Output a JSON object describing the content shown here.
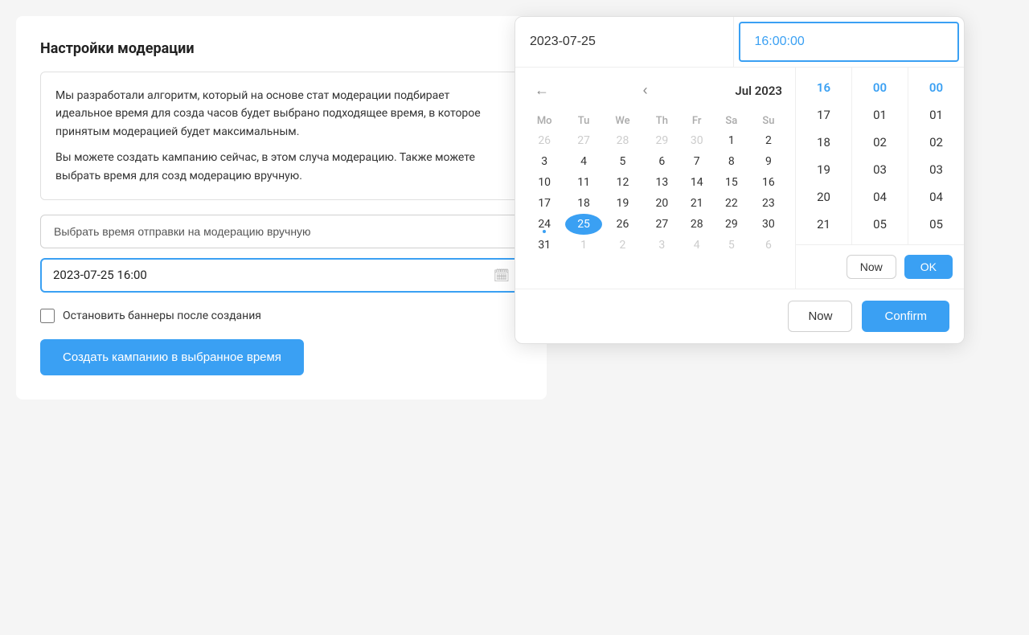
{
  "section": {
    "title": "Настройки модерации",
    "info_text_1": "Мы разработали алгоритм, который на основе стат модерации подбирает идеальное время для созда часов будет выбрано подходящее время, в которое принятым модерацией будет максимальным.",
    "info_text_2": "Вы можете создать кампанию сейчас, в этом случа модерацию. Также можете выбрать время для созд модерацию вручную.",
    "select_time_label": "Выбрать время отправки на модерацию вручную",
    "datetime_value": "2023-07-25 16:00",
    "checkbox_label": "Остановить баннеры после создания",
    "create_btn": "Создать кампанию в выбранное время"
  },
  "picker": {
    "date_input_value": "2023-07-25",
    "time_input_value": "16:00:00",
    "month_label": "Jul 2023",
    "nav_prev": "‹",
    "nav_prev2": "‹",
    "weekdays": [
      "Mo",
      "Tu",
      "We",
      "Th",
      "Fr",
      "Sa",
      "Su"
    ],
    "weeks": [
      [
        {
          "day": "26",
          "other": true
        },
        {
          "day": "27",
          "other": true
        },
        {
          "day": "28",
          "other": true
        },
        {
          "day": "29",
          "other": true
        },
        {
          "day": "30",
          "other": true
        },
        {
          "day": "1",
          "other": false
        },
        {
          "day": "2",
          "other": false
        }
      ],
      [
        {
          "day": "3",
          "other": false
        },
        {
          "day": "4",
          "other": false
        },
        {
          "day": "5",
          "other": false
        },
        {
          "day": "6",
          "other": false
        },
        {
          "day": "7",
          "other": false
        },
        {
          "day": "8",
          "other": false
        },
        {
          "day": "9",
          "other": false
        }
      ],
      [
        {
          "day": "10",
          "other": false
        },
        {
          "day": "11",
          "other": false
        },
        {
          "day": "12",
          "other": false
        },
        {
          "day": "13",
          "other": false
        },
        {
          "day": "14",
          "other": false
        },
        {
          "day": "15",
          "other": false
        },
        {
          "day": "16",
          "other": false
        }
      ],
      [
        {
          "day": "17",
          "other": false
        },
        {
          "day": "18",
          "other": false
        },
        {
          "day": "19",
          "other": false
        },
        {
          "day": "20",
          "other": false
        },
        {
          "day": "21",
          "other": false
        },
        {
          "day": "22",
          "other": false
        },
        {
          "day": "23",
          "other": false
        }
      ],
      [
        {
          "day": "24",
          "other": false,
          "dot": true
        },
        {
          "day": "25",
          "other": false,
          "selected": true
        },
        {
          "day": "26",
          "other": false
        },
        {
          "day": "27",
          "other": false
        },
        {
          "day": "28",
          "other": false
        },
        {
          "day": "29",
          "other": false
        },
        {
          "day": "30",
          "other": false
        }
      ],
      [
        {
          "day": "31",
          "other": false
        },
        {
          "day": "1",
          "other": true
        },
        {
          "day": "2",
          "other": true
        },
        {
          "day": "3",
          "other": true
        },
        {
          "day": "4",
          "other": true
        },
        {
          "day": "5",
          "other": true
        },
        {
          "day": "6",
          "other": true
        }
      ]
    ],
    "hours": [
      "16",
      "17",
      "18",
      "19",
      "20",
      "21"
    ],
    "minutes": [
      "00",
      "01",
      "02",
      "03",
      "04",
      "05"
    ],
    "seconds": [
      "00",
      "01",
      "02",
      "03",
      "04",
      "05"
    ],
    "selected_hour": "16",
    "selected_minute": "00",
    "selected_second": "00",
    "btn_now_small": "Now",
    "btn_ok": "OK",
    "btn_now_large": "Now",
    "btn_confirm": "Confirm"
  }
}
